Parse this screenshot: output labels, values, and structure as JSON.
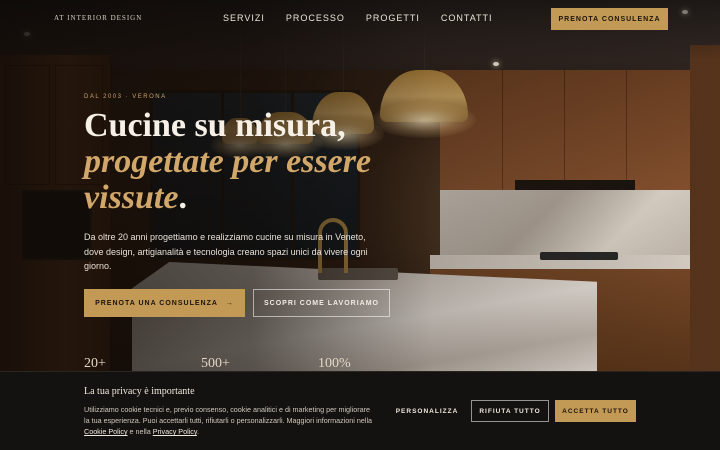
{
  "nav": {
    "logo": "AT INTERIOR DESIGN",
    "menu": [
      "SERVIZI",
      "PROCESSO",
      "PROGETTI",
      "CONTATTI"
    ],
    "cta": "PRENOTA CONSULENZA"
  },
  "hero": {
    "eyebrow": "DAL 2003 · VERONA",
    "title_line1": "Cucine su misura,",
    "title_accent": "progettate per essere vissute",
    "title_end": ".",
    "lead": "Da oltre 20 anni progettiamo e realizziamo cucine su misura in Veneto, dove design, artigianalità e tecnologia creano spazi unici da vivere ogni giorno.",
    "primary_button": "PRENOTA UNA CONSULENZA",
    "primary_arrow": "→",
    "secondary_button": "SCOPRI COME LAVORIAMO",
    "stats": [
      "20+",
      "500+",
      "100%"
    ]
  },
  "cookie": {
    "title": "La tua privacy è importante",
    "text_before": "Utilizziamo cookie tecnici e, previo consenso, cookie analitici e di marketing per migliorare la tua esperienza. Puoi accettarli tutti, rifiutarli o personalizzarli. Maggiori informazioni nella ",
    "cookie_policy_link": "Cookie Policy",
    "text_middle": " e nella ",
    "privacy_policy_link": "Privacy Policy",
    "text_after": ".",
    "personalize": "PERSONALIZZA",
    "reject": "RIFIUTA TUTTO",
    "accept": "ACCETTA TUTTO"
  },
  "colors": {
    "accent": "#c39a55",
    "accent_text": "#d2a86a",
    "banner_bg": "#141210"
  }
}
